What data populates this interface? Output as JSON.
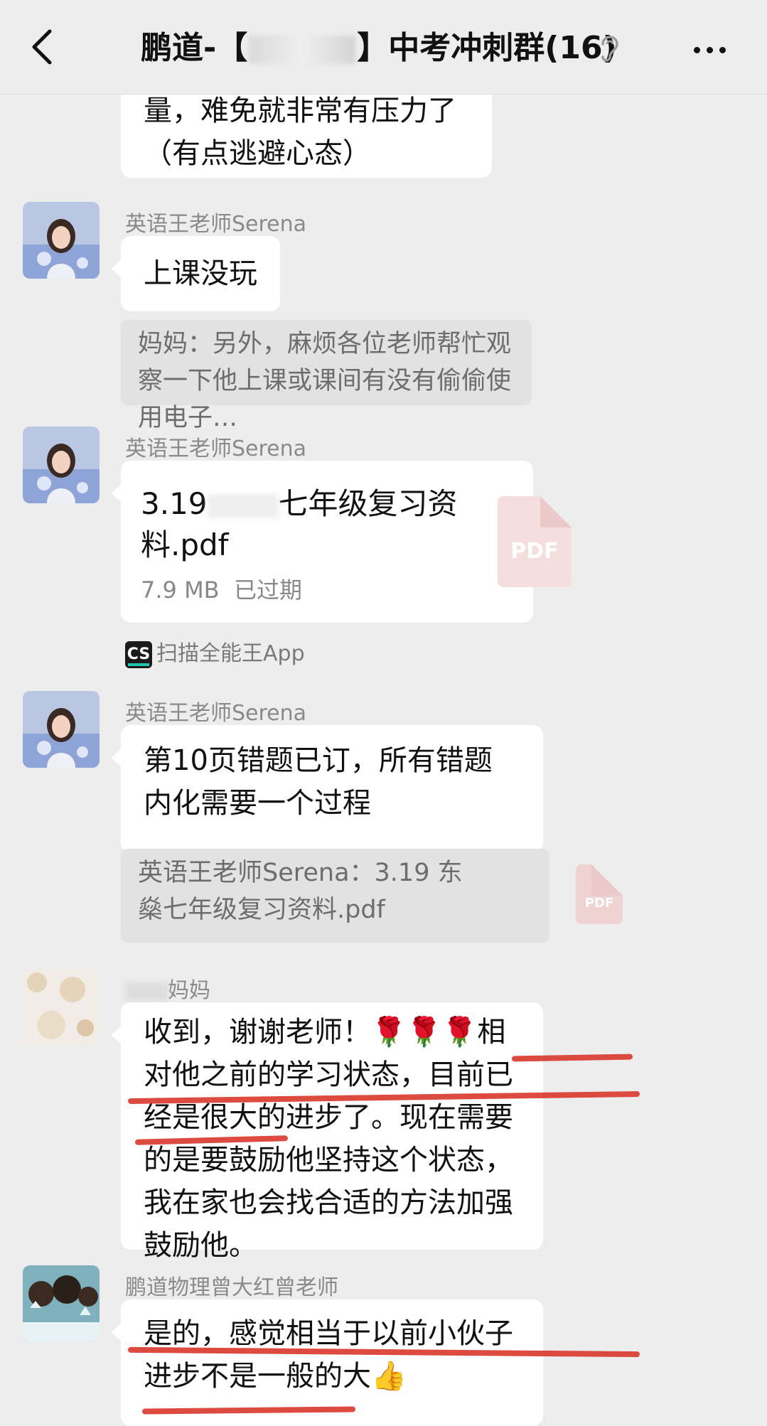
{
  "header": {
    "title_prefix": "鹏道-【",
    "title_suffix": "】中考冲刺群(16)"
  },
  "messages": [
    {
      "text": "量，难免就非常有压力了（有点逃避心态）"
    },
    {
      "sender": "英语王老师Serena",
      "text": "上课没玩",
      "quote": "妈妈：另外，麻烦各位老师帮忙观察一下他上课或课间有没有偷偷使用电子…"
    },
    {
      "sender": "英语王老师Serena",
      "file": {
        "name_line1": "3.19",
        "name_line1b": "七年级复习资",
        "name_line2": "料.pdf",
        "size": "7.9 MB",
        "status": "已过期",
        "icon": "PDF"
      },
      "source_app": "扫描全能王App",
      "source_badge": "CS"
    },
    {
      "sender": "英语王老师Serena",
      "text": "第10页错题已订，所有错题内化需要一个过程",
      "quote": "英语王老师Serena：3.19 东燊七年级复习资料.pdf",
      "quote_icon": "PDF"
    },
    {
      "sender": "妈妈",
      "text": "收到，谢谢老师！🌹🌹🌹相对他之前的学习状态，目前已经是很大的进步了。现在需要的是要鼓励他坚持这个状态，我在家也会找合适的方法加强鼓励他。"
    },
    {
      "sender": "鹏道物理曾大红曾老师",
      "text": "是的，感觉相当于以前小伙子进步不是一般的大👍"
    }
  ],
  "colors": {
    "background": "#ededed",
    "bubble": "#ffffff",
    "underline": "#d8362b",
    "pdf": "#f4dede"
  }
}
